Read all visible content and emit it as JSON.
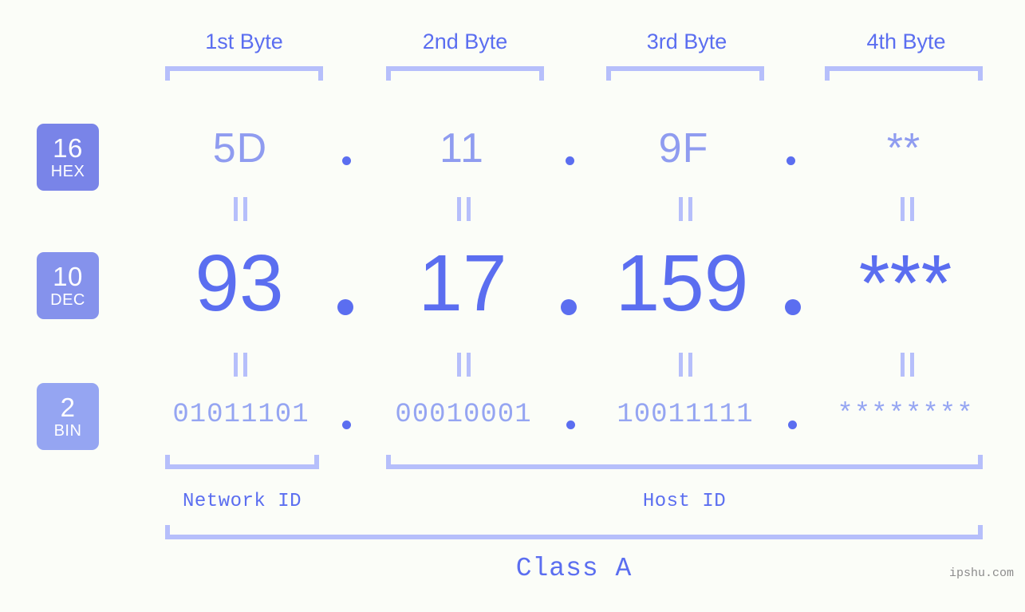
{
  "meta": {
    "background_color": "#fbfdf8",
    "accent_strong": "#5b6ef0",
    "accent_mid": "#8f9cf0",
    "accent_light": "#b6bffb"
  },
  "headers": [
    {
      "label": "1st Byte"
    },
    {
      "label": "2nd Byte"
    },
    {
      "label": "3rd Byte"
    },
    {
      "label": "4th Byte"
    }
  ],
  "radix_badges": [
    {
      "number": "16",
      "abbr": "HEX",
      "color": "#7984e8"
    },
    {
      "number": "10",
      "abbr": "DEC",
      "color": "#8592ec"
    },
    {
      "number": "2",
      "abbr": "BIN",
      "color": "#95a5f2"
    }
  ],
  "rows": {
    "hex": {
      "radix": "16",
      "name": "HEX",
      "values": [
        "5D",
        "11",
        "9F",
        "**"
      ],
      "separator": "."
    },
    "dec": {
      "radix": "10",
      "name": "DEC",
      "values": [
        "93",
        "17",
        "159",
        "***"
      ],
      "separator": "."
    },
    "bin": {
      "radix": "2",
      "name": "BIN",
      "values": [
        "01011101",
        "00010001",
        "10011111",
        "********"
      ],
      "separator": "."
    }
  },
  "equality_marker": "=",
  "sections": [
    {
      "label": "Network ID",
      "spans_bytes": "1"
    },
    {
      "label": "Host ID",
      "spans_bytes": "2-4"
    }
  ],
  "class": {
    "label": "Class A"
  },
  "watermark": {
    "text": "ipshu.com"
  }
}
